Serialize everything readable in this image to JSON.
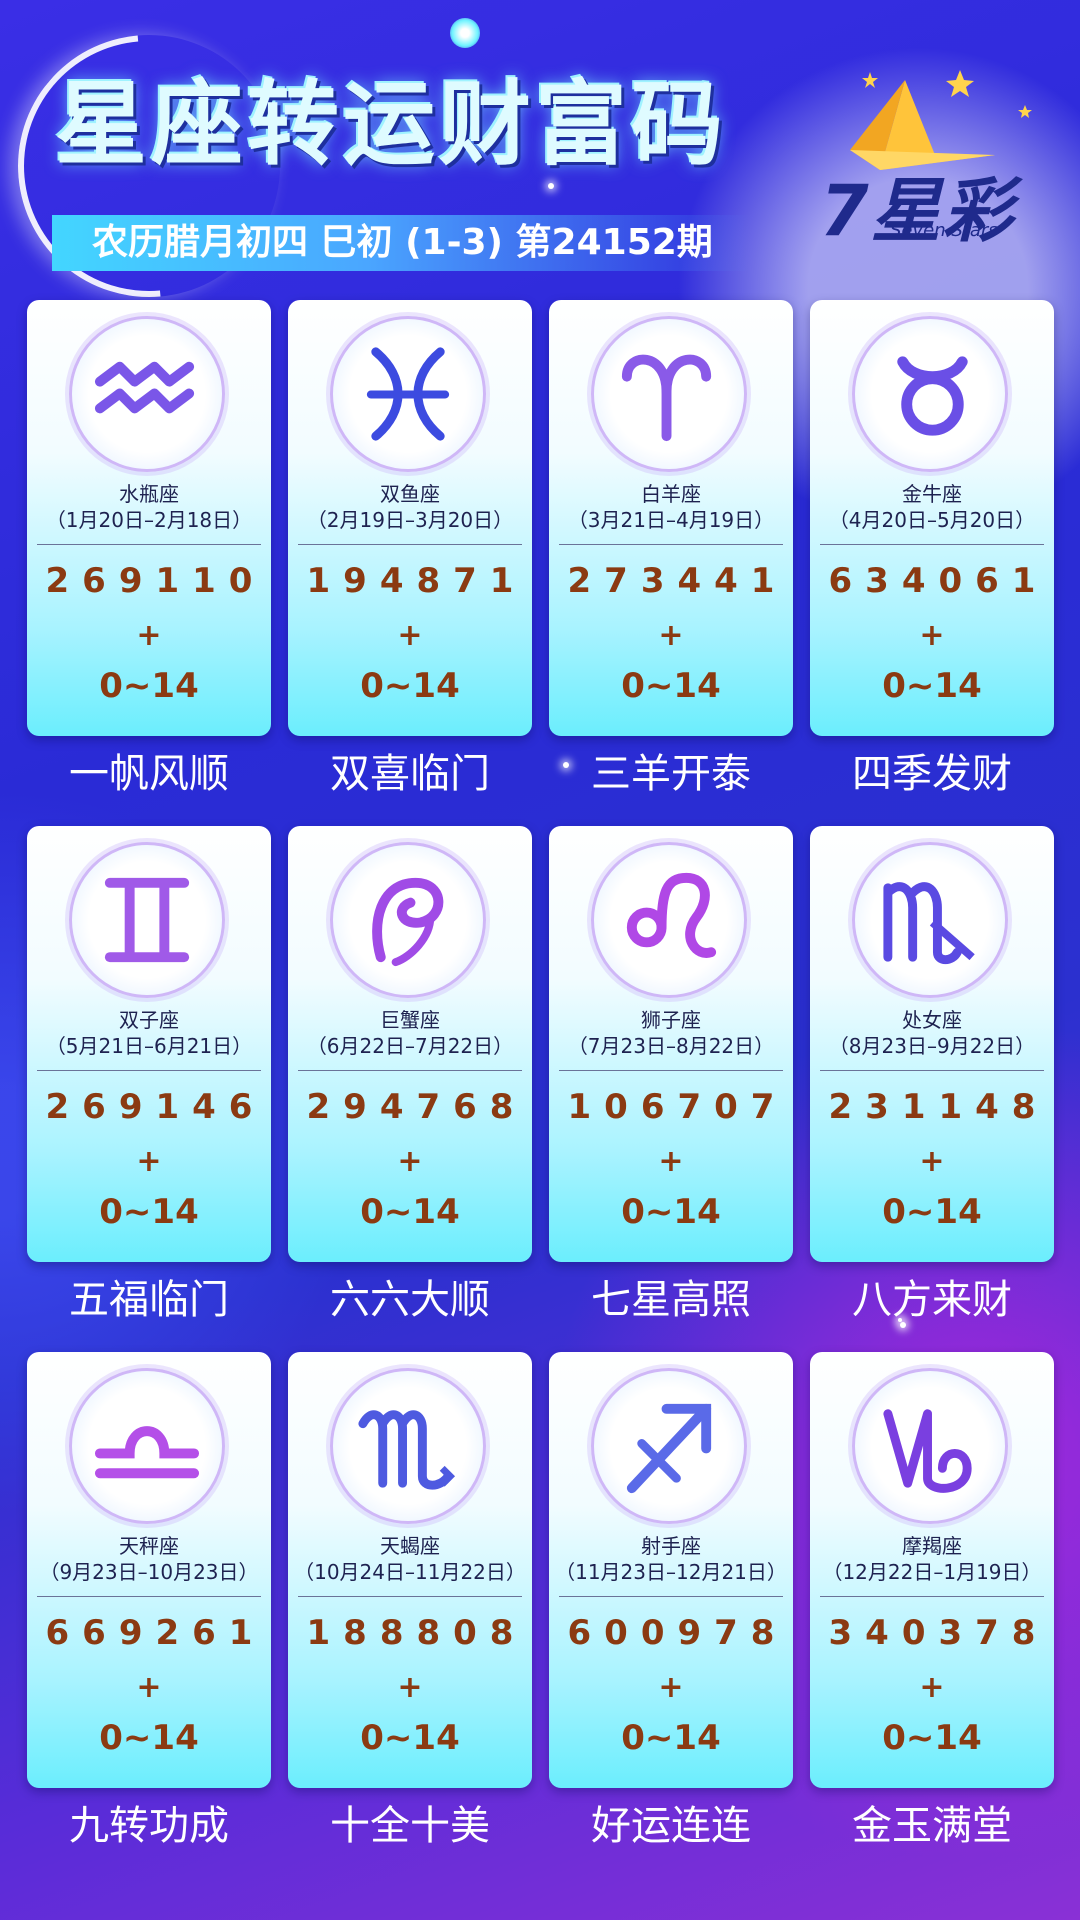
{
  "header": {
    "title": "星座转运财富码",
    "subtitle": "农历腊月初四 巳初 (1-3) 第24152期"
  },
  "logo": {
    "text": "7星彩",
    "sub": "Seven Stars"
  },
  "colors": {
    "number": "#8b3a12",
    "caption": "#ffffff",
    "background": "#2b30cf"
  },
  "cards": [
    {
      "name": "水瓶座",
      "dates": "（1月20日–2月18日）",
      "numbers": "269110",
      "plus": "+",
      "range": "0~14",
      "caption": "一帆风顺",
      "icon": "aquarius-icon"
    },
    {
      "name": "双鱼座",
      "dates": "（2月19日–3月20日）",
      "numbers": "194871",
      "plus": "+",
      "range": "0~14",
      "caption": "双喜临门",
      "icon": "pisces-icon"
    },
    {
      "name": "白羊座",
      "dates": "（3月21日–4月19日）",
      "numbers": "273441",
      "plus": "+",
      "range": "0~14",
      "caption": "三羊开泰",
      "icon": "aries-icon"
    },
    {
      "name": "金牛座",
      "dates": "（4月20日–5月20日）",
      "numbers": "634061",
      "plus": "+",
      "range": "0~14",
      "caption": "四季发财",
      "icon": "taurus-icon"
    },
    {
      "name": "双子座",
      "dates": "（5月21日–6月21日）",
      "numbers": "269146",
      "plus": "+",
      "range": "0~14",
      "caption": "五福临门",
      "icon": "gemini-icon"
    },
    {
      "name": "巨蟹座",
      "dates": "（6月22日–7月22日）",
      "numbers": "294768",
      "plus": "+",
      "range": "0~14",
      "caption": "六六大顺",
      "icon": "cancer-icon"
    },
    {
      "name": "狮子座",
      "dates": "（7月23日–8月22日）",
      "numbers": "106707",
      "plus": "+",
      "range": "0~14",
      "caption": "七星高照",
      "icon": "leo-icon"
    },
    {
      "name": "处女座",
      "dates": "（8月23日–9月22日）",
      "numbers": "231148",
      "plus": "+",
      "range": "0~14",
      "caption": "八方来财",
      "icon": "virgo-icon"
    },
    {
      "name": "天秤座",
      "dates": "（9月23日–10月23日）",
      "numbers": "669261",
      "plus": "+",
      "range": "0~14",
      "caption": "九转功成",
      "icon": "libra-icon"
    },
    {
      "name": "天蝎座",
      "dates": "（10月24日–11月22日）",
      "numbers": "188808",
      "plus": "+",
      "range": "0~14",
      "caption": "十全十美",
      "icon": "scorpio-icon"
    },
    {
      "name": "射手座",
      "dates": "（11月23日–12月21日）",
      "numbers": "600978",
      "plus": "+",
      "range": "0~14",
      "caption": "好运连连",
      "icon": "sagittarius-icon"
    },
    {
      "name": "摩羯座",
      "dates": "（12月22日–1月19日）",
      "numbers": "340378",
      "plus": "+",
      "range": "0~14",
      "caption": "金玉满堂",
      "icon": "capricorn-icon"
    }
  ]
}
